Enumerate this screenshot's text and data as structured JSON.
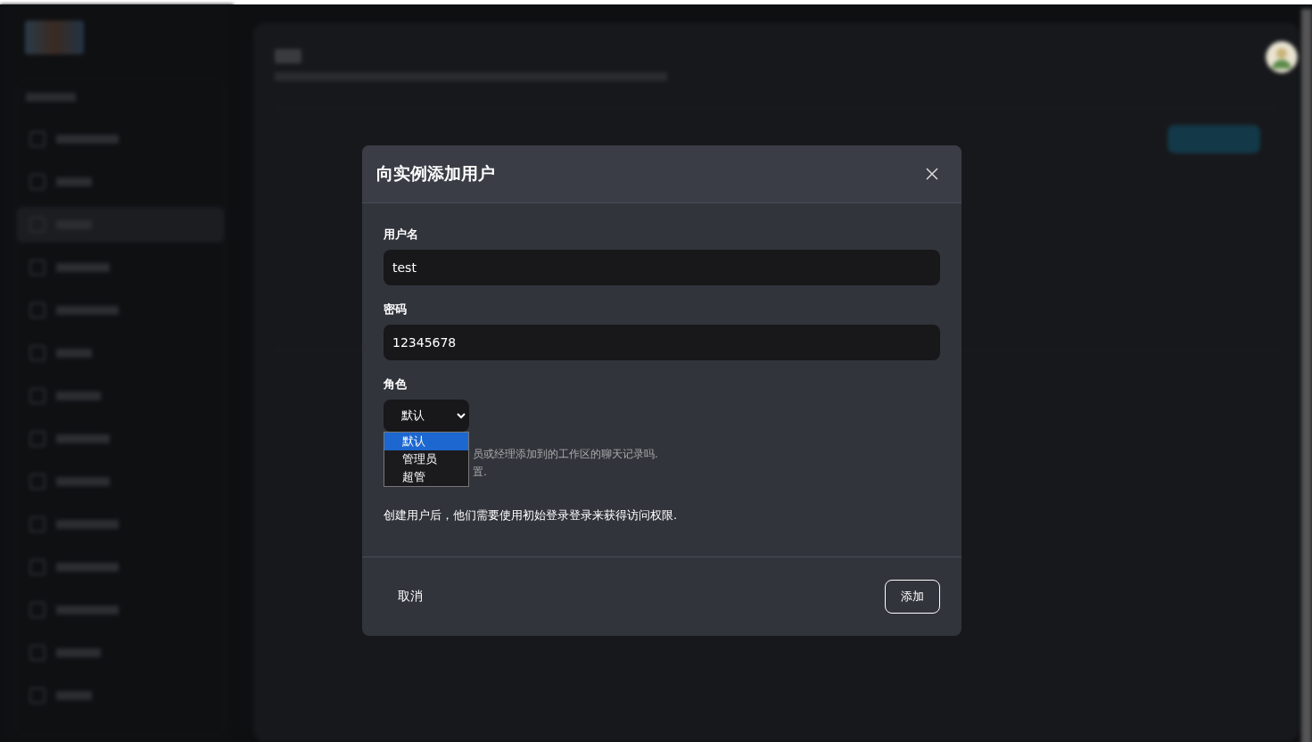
{
  "dialog": {
    "title": "向实例添加用户",
    "fields": [
      {
        "label": "用户名",
        "value": "test",
        "kind": "text"
      },
      {
        "label": "密码",
        "value": "12345678",
        "kind": "text"
      }
    ],
    "role": {
      "label": "角色",
      "value": "默认",
      "options": [
        {
          "label": "默认",
          "selected": true
        },
        {
          "label": "管理员",
          "selected": false
        },
        {
          "label": "超管",
          "selected": false
        }
      ]
    },
    "hint_lines": [
      "员或经理添加到的工作区的聊天记录吗.",
      "置."
    ],
    "note": "创建用户后，他们需要使用初始登录登录来获得访问权限.",
    "cancel": "取消",
    "submit": "添加"
  }
}
